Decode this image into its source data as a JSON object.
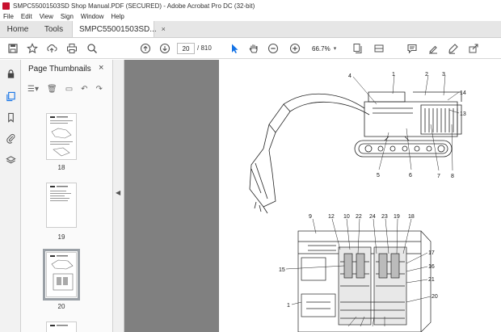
{
  "window": {
    "title": "SMPC55001503SD Shop Manual.PDF (SECURED) - Adobe Acrobat Pro DC (32-bit)"
  },
  "menu": [
    "File",
    "Edit",
    "View",
    "Sign",
    "Window",
    "Help"
  ],
  "tabs": {
    "home": "Home",
    "tools": "Tools",
    "document": "SMPC55001503SD...",
    "close": "×"
  },
  "toolbar": {
    "current_page": "20",
    "total_pages": "/ 810",
    "zoom": "66.7%"
  },
  "panel": {
    "title": "Page Thumbnails",
    "close": "×",
    "thumbnails": [
      {
        "label": "18"
      },
      {
        "label": "19"
      },
      {
        "label": "20",
        "selected": true
      }
    ]
  },
  "diagram": {
    "top_labels": [
      "4",
      "1",
      "2",
      "3",
      "14",
      "13",
      "5",
      "6",
      "7",
      "8"
    ],
    "bottom_labels": [
      "9",
      "12",
      "10",
      "22",
      "24",
      "23",
      "19",
      "18",
      "17",
      "16",
      "15",
      "21",
      "20",
      "1"
    ]
  },
  "icons": {
    "save": "save-icon",
    "star": "star-icon",
    "upload": "upload-icon",
    "print": "print-icon",
    "search": "search-icon",
    "up": "arrow-up-icon",
    "down": "arrow-down-icon",
    "select": "cursor-icon",
    "hand": "hand-icon",
    "zoomout": "zoom-out-icon",
    "zoomin": "zoom-in-icon"
  }
}
